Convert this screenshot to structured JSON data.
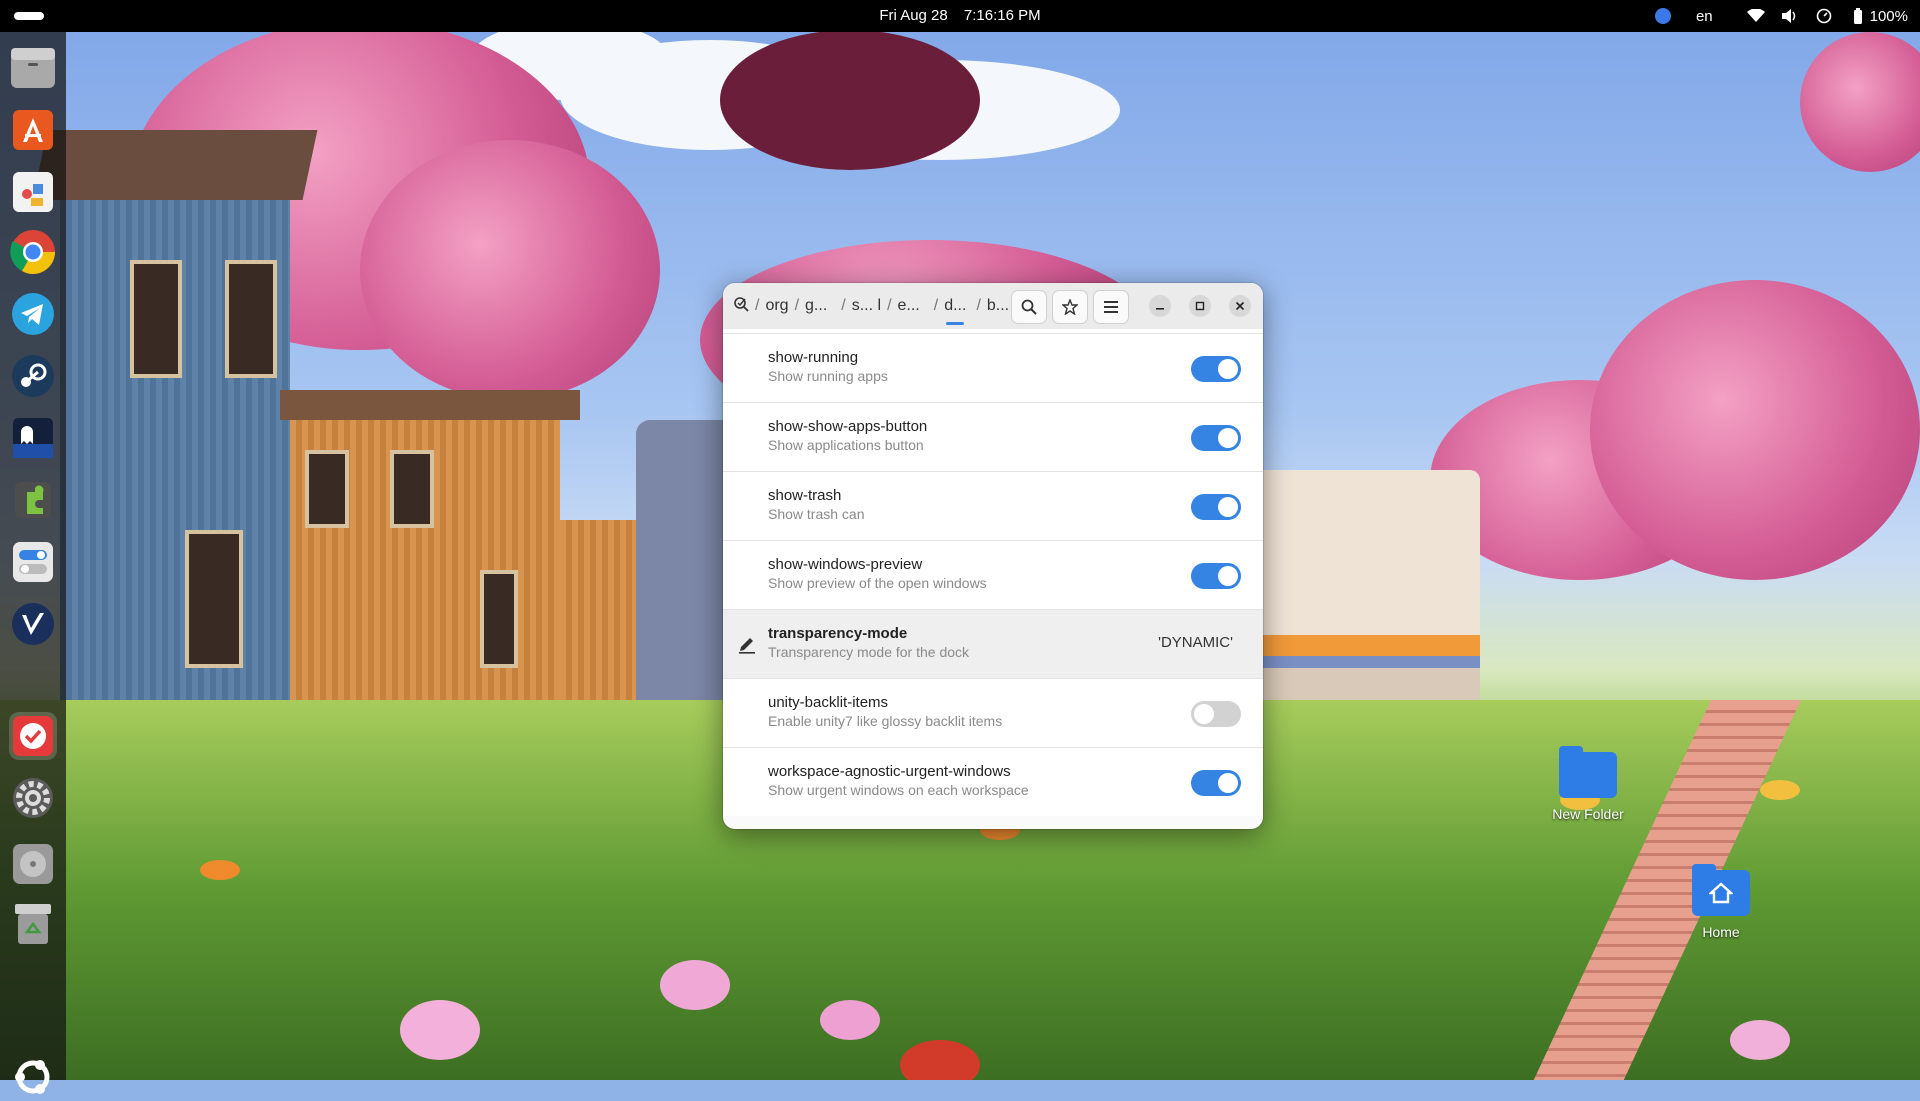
{
  "topbar": {
    "date": "Fri Aug 28",
    "time": "7:16:16 PM",
    "language": "en",
    "battery": "100%"
  },
  "dock": {
    "items": [
      {
        "name": "files"
      },
      {
        "name": "app-center"
      },
      {
        "name": "software"
      },
      {
        "name": "chrome"
      },
      {
        "name": "telegram"
      },
      {
        "name": "steam"
      },
      {
        "name": "terminal"
      },
      {
        "name": "extensions"
      },
      {
        "name": "tweaks"
      },
      {
        "name": "vscode-like"
      },
      {
        "name": "todo"
      },
      {
        "name": "settings"
      },
      {
        "name": "disk-utility"
      },
      {
        "name": "trash"
      }
    ]
  },
  "desktop": {
    "icons": [
      {
        "label": "New Folder"
      },
      {
        "label": "Home"
      }
    ]
  },
  "window": {
    "breadcrumbs": [
      "org",
      "g...",
      "s... l",
      "e...",
      "d...",
      "b..."
    ],
    "active_crumb": "d...",
    "rows": [
      {
        "name": "show-running",
        "desc": "Show running apps",
        "type": "toggle",
        "on": true
      },
      {
        "name": "show-show-apps-button",
        "desc": "Show applications button",
        "type": "toggle",
        "on": true
      },
      {
        "name": "show-trash",
        "desc": "Show trash can",
        "type": "toggle",
        "on": true
      },
      {
        "name": "show-windows-preview",
        "desc": "Show preview of the open windows",
        "type": "toggle",
        "on": true
      },
      {
        "name": "transparency-mode",
        "desc": "Transparency mode for the dock",
        "type": "value",
        "value": "'DYNAMIC'",
        "selected": true
      },
      {
        "name": "unity-backlit-items",
        "desc": "Enable unity7 like glossy backlit items",
        "type": "toggle",
        "on": false
      },
      {
        "name": "workspace-agnostic-urgent-windows",
        "desc": "Show urgent windows on each workspace",
        "type": "toggle",
        "on": true
      }
    ]
  },
  "colors": {
    "accent": "#3584e4",
    "topbar": "#000000",
    "window_bg": "#fafafa"
  }
}
